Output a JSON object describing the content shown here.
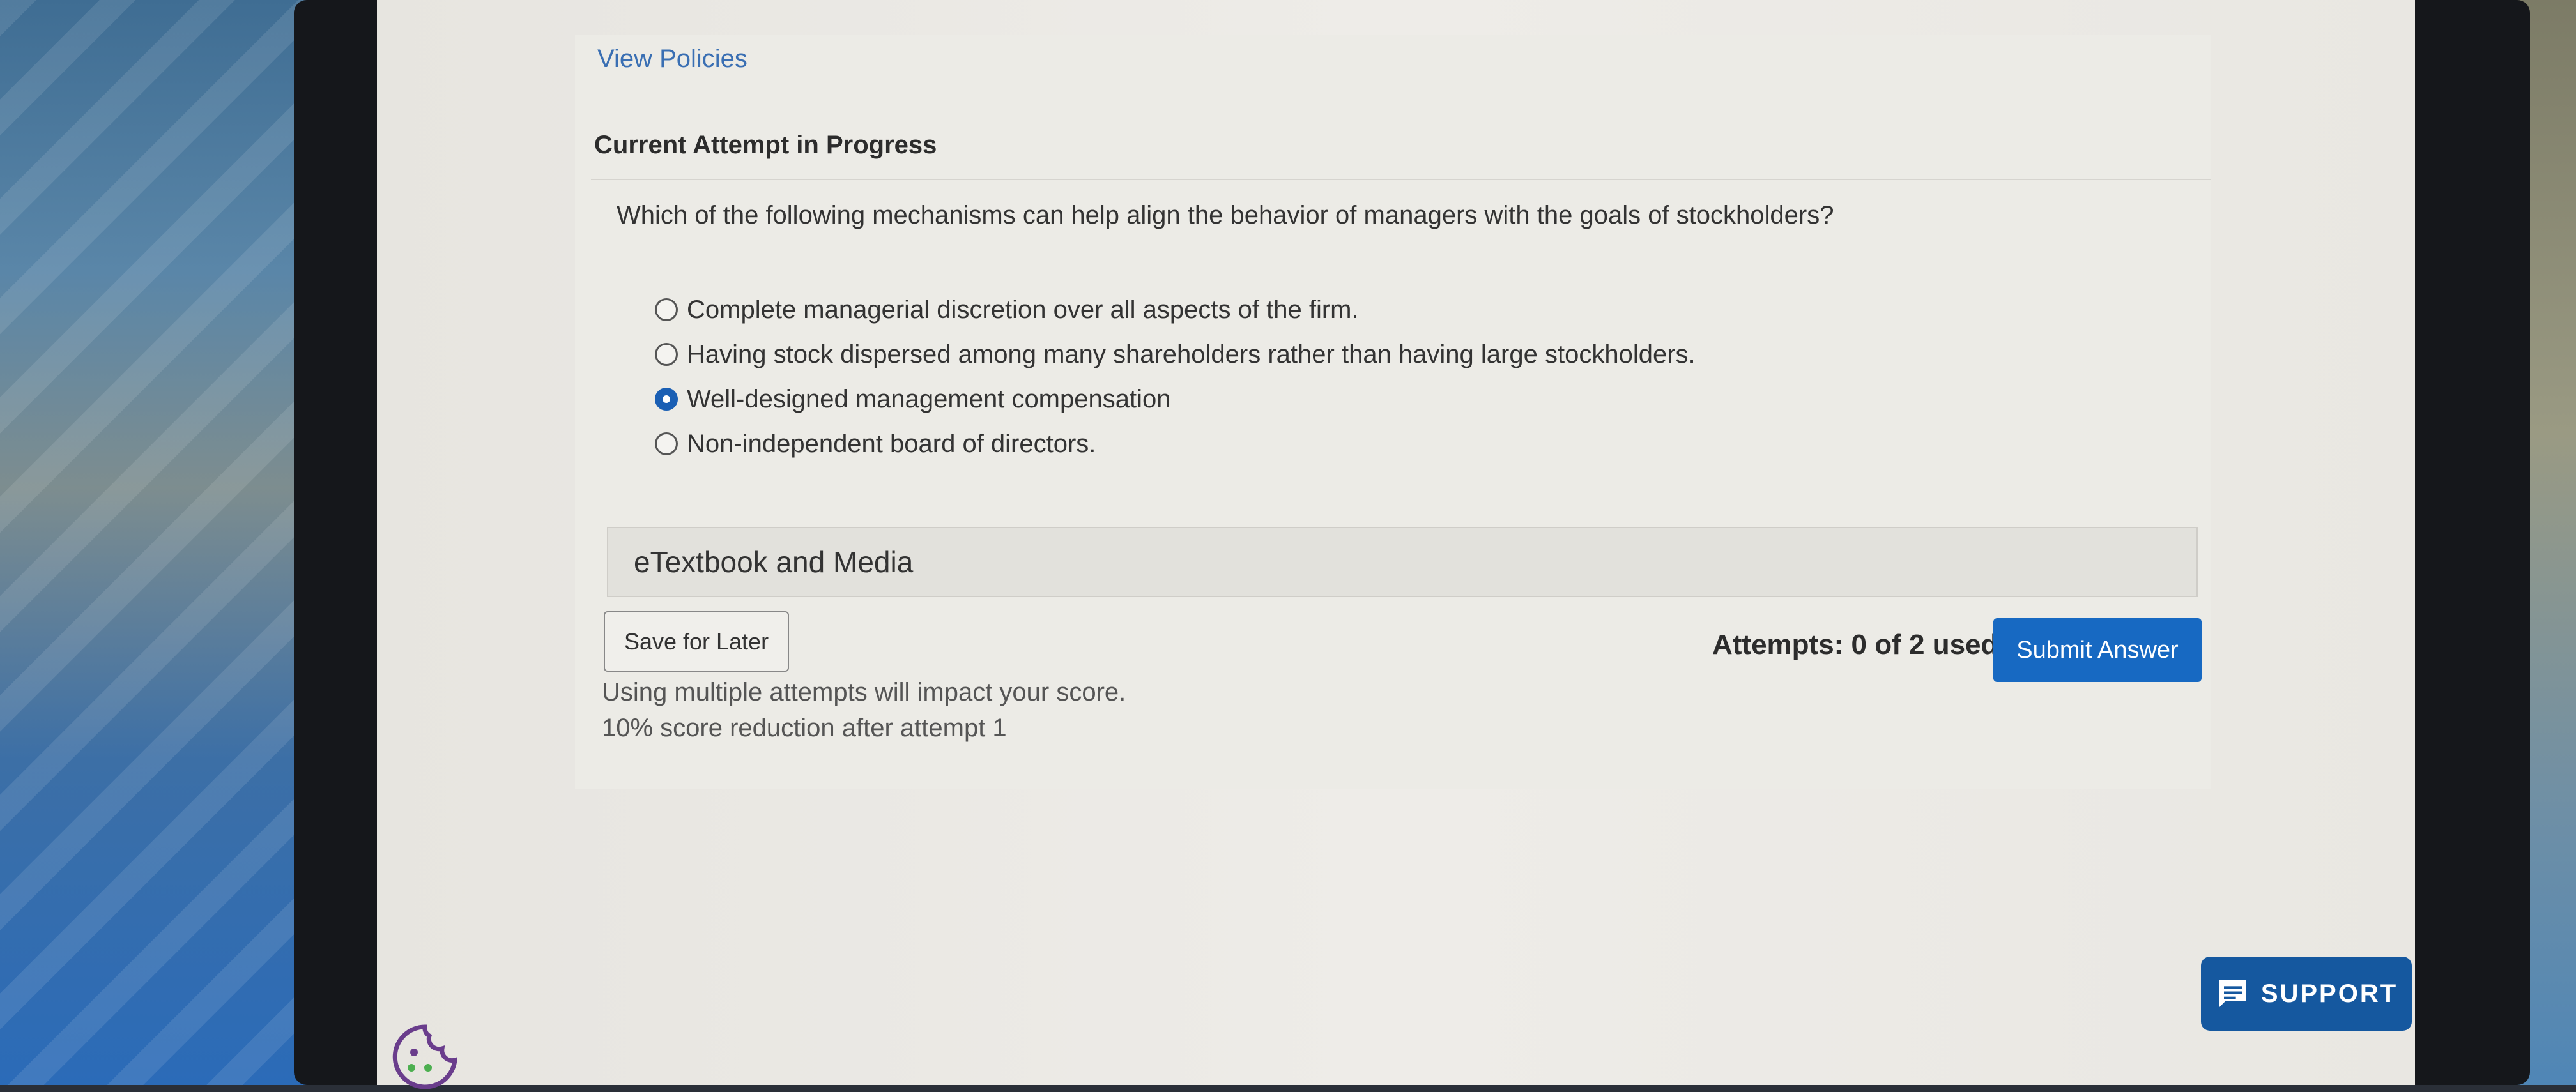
{
  "header": {
    "view_policies": "View Policies"
  },
  "section": {
    "title": "Current Attempt in Progress"
  },
  "question": {
    "text": "Which of the following mechanisms can help align the behavior of managers with the goals of stockholders?",
    "options": [
      {
        "label": "Complete managerial discretion over all aspects of the firm.",
        "selected": false
      },
      {
        "label": "Having stock dispersed among many shareholders rather than having large stockholders.",
        "selected": false
      },
      {
        "label": "Well-designed management compensation",
        "selected": true
      },
      {
        "label": "Non-independent board of directors.",
        "selected": false
      }
    ]
  },
  "media": {
    "label": "eTextbook and Media"
  },
  "actions": {
    "save_label": "Save for Later",
    "attempts_text": "Attempts: 0 of 2 used",
    "submit_label": "Submit Answer"
  },
  "notes": {
    "line1": "Using multiple attempts will impact your score.",
    "line2": "10% score reduction after attempt 1"
  },
  "support": {
    "label": "SUPPORT",
    "icon": "chat-icon"
  },
  "cookie": {
    "icon": "cookie-icon"
  },
  "colors": {
    "accent": "#1769c2",
    "support": "#15589f",
    "link": "#3a6fb3"
  }
}
